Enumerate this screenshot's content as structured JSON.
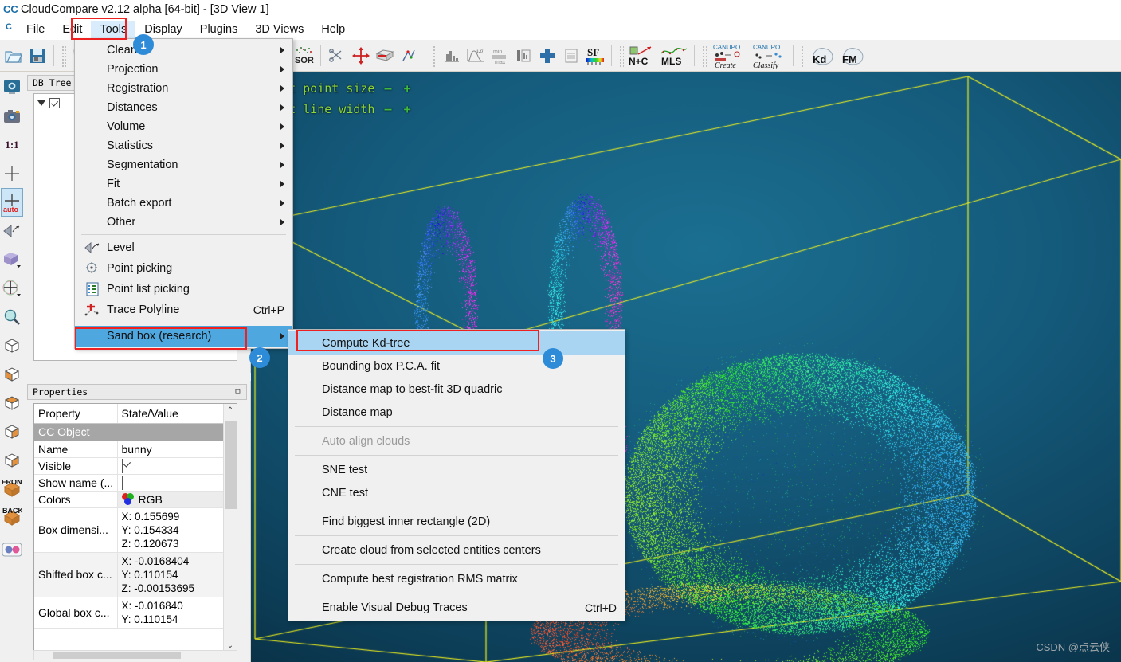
{
  "window": {
    "title": "CloudCompare v2.12 alpha [64-bit] - [3D View 1]",
    "app_icon": "cloudcompare-logo-icon"
  },
  "menubar": {
    "items": [
      {
        "label": "File",
        "active": false
      },
      {
        "label": "Edit",
        "active": false
      },
      {
        "label": "Tools",
        "active": true
      },
      {
        "label": "Display",
        "active": false
      },
      {
        "label": "Plugins",
        "active": false
      },
      {
        "label": "3D Views",
        "active": false
      },
      {
        "label": "Help",
        "active": false
      }
    ]
  },
  "toolbar": {
    "groups": [
      {
        "icons": [
          {
            "name": "open-file-icon",
            "glyph": "📂"
          },
          {
            "name": "save-file-icon",
            "glyph": "💾"
          }
        ]
      },
      {
        "icons": [
          {
            "name": "clone-cloud-icon",
            "glyph": "◳"
          },
          {
            "name": "merge-clouds-icon",
            "glyph": "◱"
          },
          {
            "name": "subsample-icon",
            "glyph": "⁙"
          },
          {
            "name": "delete-entity-icon",
            "glyph": "▧"
          },
          {
            "name": "segment-icon",
            "glyph": "◩"
          },
          {
            "name": "compute-normals-icon",
            "glyph": "⁘"
          },
          {
            "name": "cloud-cloud-dist-icon",
            "glyph": "CC"
          },
          {
            "name": "cloud-mesh-dist-icon",
            "glyph": "🏺"
          }
        ]
      },
      {
        "icons": [
          {
            "name": "checker-filter-icon",
            "glyph": "▦"
          },
          {
            "name": "sor-filter-icon",
            "glyph": "SOR"
          },
          {
            "name": "scissors-icon",
            "glyph": "✂"
          },
          {
            "name": "translate-rotate-icon",
            "glyph": "✥"
          },
          {
            "name": "cross-section-icon",
            "glyph": "▤"
          },
          {
            "name": "point-pair-align-icon",
            "glyph": "⚡"
          }
        ]
      },
      {
        "icons": [
          {
            "name": "histogram-icon",
            "glyph": "▁▃▅"
          },
          {
            "name": "gauss-filter-icon",
            "glyph": "μ,σ"
          },
          {
            "name": "min-max-icon",
            "glyph": "min/max"
          },
          {
            "name": "sf-to-color-icon",
            "glyph": "▥"
          },
          {
            "name": "add-sf-icon",
            "glyph": "✚"
          },
          {
            "name": "sf-arithmetic-icon",
            "glyph": "▤"
          },
          {
            "name": "sf-colorscale-icon",
            "glyph": "SF"
          }
        ]
      },
      {
        "icons": [
          {
            "name": "normals-to-curvature-icon",
            "glyph": "N+C"
          },
          {
            "name": "mls-smoothing-icon",
            "glyph": "MLS"
          }
        ]
      },
      {
        "icons": [
          {
            "name": "canupo-create-icon",
            "glyph": "CANUPO Create"
          },
          {
            "name": "canupo-classify-icon",
            "glyph": "CANUPO Classify"
          }
        ]
      },
      {
        "icons": [
          {
            "name": "kd-tree-plugin-icon",
            "glyph": "Kd"
          },
          {
            "name": "fm-plugin-icon",
            "glyph": "FM"
          }
        ]
      }
    ]
  },
  "left_toolbar": {
    "items": [
      {
        "name": "global-zoom-icon",
        "glyph": "🖵",
        "selected": false
      },
      {
        "name": "camera-settings-icon",
        "glyph": "📷",
        "selected": false
      },
      {
        "name": "zoom-1to1-icon",
        "glyph": "1:1",
        "selected": false
      },
      {
        "name": "pick-rotation-center-icon",
        "glyph": "✛",
        "selected": false
      },
      {
        "name": "auto-pick-rotation-center-icon",
        "glyph": "auto",
        "selected": true
      },
      {
        "name": "level-tool-icon",
        "glyph": "◁",
        "selected": false
      },
      {
        "name": "set-view-orientation-icon",
        "glyph": "▰",
        "selected": false
      },
      {
        "name": "rotation-axis-icon",
        "glyph": "✥",
        "selected": false
      },
      {
        "name": "zoom-box-icon",
        "glyph": "🔍",
        "selected": false
      },
      {
        "name": "view-top-icon",
        "glyph": "▣",
        "selected": false
      },
      {
        "name": "view-bottom-icon",
        "glyph": "▣",
        "selected": false
      },
      {
        "name": "view-left-icon",
        "glyph": "▣",
        "selected": false
      },
      {
        "name": "view-right-icon",
        "glyph": "▣",
        "selected": false
      },
      {
        "name": "view-iso1-icon",
        "glyph": "▣",
        "selected": false
      },
      {
        "name": "view-iso2-icon",
        "glyph": "▣",
        "selected": false
      },
      {
        "name": "view-front-icon",
        "glyph": "FRONT",
        "selected": false
      },
      {
        "name": "view-back-icon",
        "glyph": "BACK",
        "selected": false
      },
      {
        "name": "stereo-mode-icon",
        "glyph": "◉◉",
        "selected": false
      }
    ]
  },
  "db_tree": {
    "title": "DB Tree",
    "float_icon": "undock-icon",
    "rows": [
      {
        "expander": "collapse-arrow-icon",
        "checked": true,
        "label": ""
      }
    ]
  },
  "properties": {
    "title": "Properties",
    "float_icon": "undock-icon",
    "columns": [
      "Property",
      "State/Value"
    ],
    "rows": [
      {
        "type": "section",
        "label": "CC Object"
      },
      {
        "type": "text",
        "label": "Name",
        "value": "bunny"
      },
      {
        "type": "checkbox",
        "label": "Visible",
        "checked": true
      },
      {
        "type": "checkbox",
        "label": "Show name (...",
        "checked": false
      },
      {
        "type": "color",
        "label": "Colors",
        "value": "RGB",
        "icon": "rgb-balls-icon"
      },
      {
        "type": "xyz",
        "label": "Box dimensi...",
        "x": "X: 0.155699",
        "y": "Y: 0.154334",
        "z": "Z: 0.120673"
      },
      {
        "type": "xyz",
        "label": "Shifted box c...",
        "x": "X: -0.0168404",
        "y": "Y: 0.110154",
        "z": "Z: -0.00153695"
      },
      {
        "type": "xyz2",
        "label": "Global box c...",
        "x": "X: -0.016840",
        "y": "Y: 0.110154"
      }
    ],
    "scroll_up_icon": "chevron-up-icon",
    "scroll_down_icon": "chevron-down-icon"
  },
  "view3d": {
    "overlay_lines": [
      {
        "text": "ault point size",
        "minus": "—",
        "plus": "+"
      },
      {
        "text": "ault line width",
        "minus": "—",
        "plus": "+"
      }
    ],
    "watermark": "CSDN @点云侠",
    "bbox_color": "#f2f21c",
    "bg_top": "#1b6f91",
    "bg_bottom": "#041a26"
  },
  "tools_menu": {
    "items": [
      {
        "label": "Clean",
        "submenu": true,
        "icon": null
      },
      {
        "label": "Projection",
        "submenu": true,
        "icon": null
      },
      {
        "label": "Registration",
        "submenu": true,
        "icon": null
      },
      {
        "label": "Distances",
        "submenu": true,
        "icon": null
      },
      {
        "label": "Volume",
        "submenu": true,
        "icon": null
      },
      {
        "label": "Statistics",
        "submenu": true,
        "icon": null
      },
      {
        "label": "Segmentation",
        "submenu": true,
        "icon": null
      },
      {
        "label": "Fit",
        "submenu": true,
        "icon": null
      },
      {
        "label": "Batch export",
        "submenu": true,
        "icon": null
      },
      {
        "label": "Other",
        "submenu": true,
        "icon": null
      },
      {
        "separator": true
      },
      {
        "label": "Level",
        "submenu": false,
        "icon": "level-icon"
      },
      {
        "label": "Point picking",
        "submenu": false,
        "icon": "point-picking-icon"
      },
      {
        "label": "Point list picking",
        "submenu": false,
        "icon": "point-list-picking-icon"
      },
      {
        "label": "Trace Polyline",
        "submenu": false,
        "icon": "trace-polyline-icon",
        "shortcut": "Ctrl+P"
      },
      {
        "separator": true
      },
      {
        "label": "Sand box (research)",
        "submenu": true,
        "icon": null,
        "highlighted": true
      }
    ]
  },
  "sandbox_menu": {
    "items": [
      {
        "label": "Compute Kd-tree",
        "highlighted": true
      },
      {
        "label": "Bounding box P.C.A. fit"
      },
      {
        "label": "Distance map to best-fit 3D quadric"
      },
      {
        "label": "Distance map"
      },
      {
        "separator": true
      },
      {
        "label": "Auto align clouds",
        "disabled": true
      },
      {
        "separator": true
      },
      {
        "label": "SNE test"
      },
      {
        "label": "CNE test"
      },
      {
        "separator": true
      },
      {
        "label": "Find biggest inner rectangle (2D)"
      },
      {
        "separator": true
      },
      {
        "label": "Create cloud from selected entities centers"
      },
      {
        "separator": true
      },
      {
        "label": "Compute best registration RMS matrix"
      },
      {
        "separator": true
      },
      {
        "label": "Enable Visual Debug Traces",
        "shortcut": "Ctrl+D"
      }
    ]
  },
  "annotations": {
    "badges": [
      {
        "number": "1",
        "target": "tools-menu-button"
      },
      {
        "number": "2",
        "target": "sand-box-menu-item"
      },
      {
        "number": "3",
        "target": "compute-kd-tree-menu-item"
      }
    ],
    "highlight_color": "#ee2020",
    "badge_color": "#2e8bd8"
  }
}
